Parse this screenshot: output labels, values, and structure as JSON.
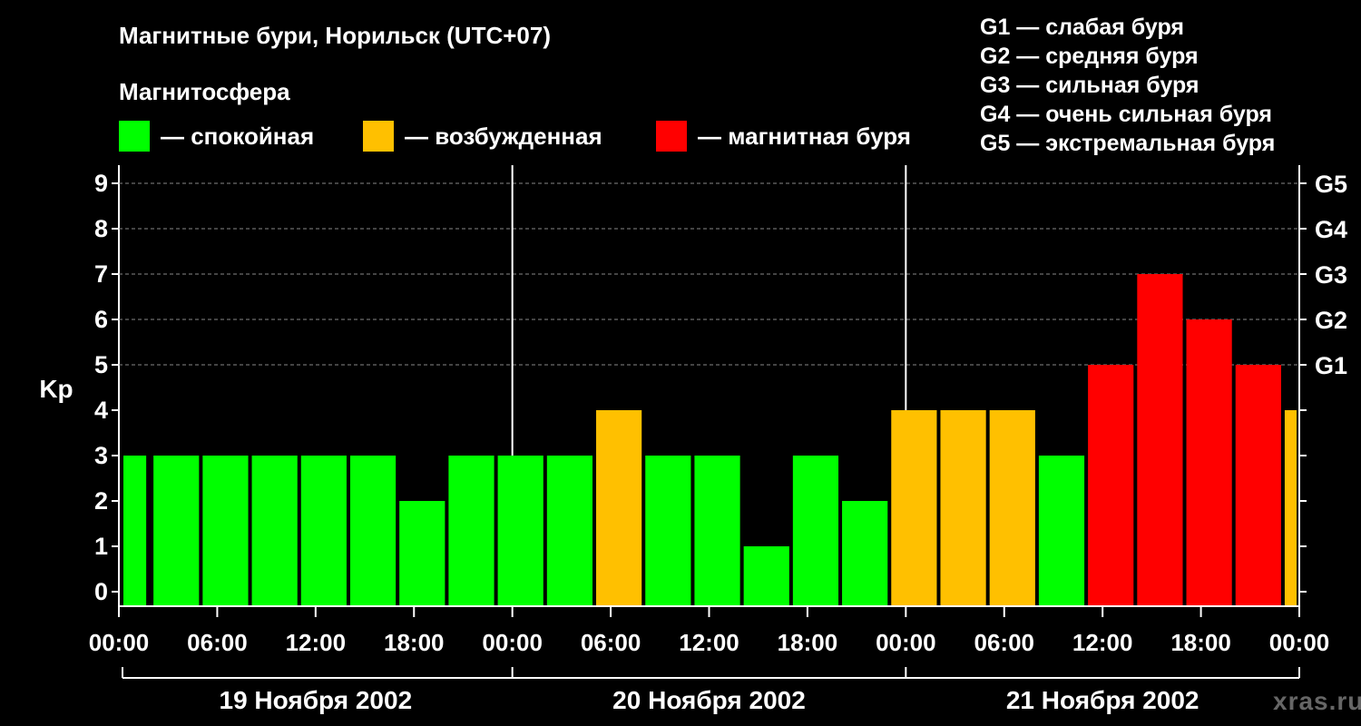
{
  "header": {
    "title": "Магнитные бури, Норильск (UTC+07)",
    "subtitle": "Магнитосфера"
  },
  "legend": [
    {
      "label": "— спокойная",
      "color": "#00ff00"
    },
    {
      "label": "— возбужденная",
      "color": "#ffc000"
    },
    {
      "label": "— магнитная буря",
      "color": "#ff0000"
    }
  ],
  "gscale": [
    "G1 — слабая буря",
    "G2 — средняя буря",
    "G3 — сильная буря",
    "G4 — очень сильная буря",
    "G5 — экстремальная буря"
  ],
  "watermark": "xras.ru",
  "chart_data": {
    "type": "bar",
    "ylabel": "Kp",
    "ylim": [
      0,
      9
    ],
    "yticks": [
      0,
      1,
      2,
      3,
      4,
      5,
      6,
      7,
      8,
      9
    ],
    "right_labels": [
      {
        "y": 5,
        "label": "G1"
      },
      {
        "y": 6,
        "label": "G2"
      },
      {
        "y": 7,
        "label": "G3"
      },
      {
        "y": 8,
        "label": "G4"
      },
      {
        "y": 9,
        "label": "G5"
      }
    ],
    "x_time_ticks": [
      "00:00",
      "06:00",
      "12:00",
      "18:00",
      "00:00",
      "06:00",
      "12:00",
      "18:00",
      "00:00",
      "06:00",
      "12:00",
      "18:00",
      "00:00"
    ],
    "days": [
      "19 Ноября 2002",
      "20 Ноября 2002",
      "21 Ноября 2002"
    ],
    "grid": "horizontal dashed",
    "bars": [
      {
        "start": "19 Ноября 2002 00:00",
        "value": 3,
        "status": "спокойная",
        "color": "#00ff00"
      },
      {
        "start": "19 Ноября 2002 02:00",
        "value": 3,
        "status": "спокойная",
        "color": "#00ff00"
      },
      {
        "start": "19 Ноября 2002 05:00",
        "value": 3,
        "status": "спокойная",
        "color": "#00ff00"
      },
      {
        "start": "19 Ноября 2002 08:00",
        "value": 3,
        "status": "спокойная",
        "color": "#00ff00"
      },
      {
        "start": "19 Ноября 2002 11:00",
        "value": 3,
        "status": "спокойная",
        "color": "#00ff00"
      },
      {
        "start": "19 Ноября 2002 14:00",
        "value": 3,
        "status": "спокойная",
        "color": "#00ff00"
      },
      {
        "start": "19 Ноября 2002 17:00",
        "value": 2,
        "status": "спокойная",
        "color": "#00ff00"
      },
      {
        "start": "19 Ноября 2002 20:00",
        "value": 3,
        "status": "спокойная",
        "color": "#00ff00"
      },
      {
        "start": "19 Ноября 2002 23:00",
        "value": 3,
        "status": "спокойная",
        "color": "#00ff00"
      },
      {
        "start": "20 Ноября 2002 02:00",
        "value": 3,
        "status": "спокойная",
        "color": "#00ff00"
      },
      {
        "start": "20 Ноября 2002 05:00",
        "value": 4,
        "status": "возбужденная",
        "color": "#ffc000"
      },
      {
        "start": "20 Ноября 2002 08:00",
        "value": 3,
        "status": "спокойная",
        "color": "#00ff00"
      },
      {
        "start": "20 Ноября 2002 11:00",
        "value": 3,
        "status": "спокойная",
        "color": "#00ff00"
      },
      {
        "start": "20 Ноября 2002 14:00",
        "value": 1,
        "status": "спокойная",
        "color": "#00ff00"
      },
      {
        "start": "20 Ноября 2002 17:00",
        "value": 3,
        "status": "спокойная",
        "color": "#00ff00"
      },
      {
        "start": "20 Ноября 2002 20:00",
        "value": 2,
        "status": "спокойная",
        "color": "#00ff00"
      },
      {
        "start": "20 Ноября 2002 23:00",
        "value": 4,
        "status": "возбужденная",
        "color": "#ffc000"
      },
      {
        "start": "21 Ноября 2002 02:00",
        "value": 4,
        "status": "возбужденная",
        "color": "#ffc000"
      },
      {
        "start": "21 Ноября 2002 05:00",
        "value": 4,
        "status": "возбужденная",
        "color": "#ffc000"
      },
      {
        "start": "21 Ноября 2002 08:00",
        "value": 3,
        "status": "спокойная",
        "color": "#00ff00"
      },
      {
        "start": "21 Ноября 2002 11:00",
        "value": 5,
        "status": "магнитная буря",
        "color": "#ff0000"
      },
      {
        "start": "21 Ноября 2002 14:00",
        "value": 7,
        "status": "магнитная буря",
        "color": "#ff0000"
      },
      {
        "start": "21 Ноября 2002 17:00",
        "value": 6,
        "status": "магнитная буря",
        "color": "#ff0000"
      },
      {
        "start": "21 Ноября 2002 20:00",
        "value": 5,
        "status": "магнитная буря",
        "color": "#ff0000"
      },
      {
        "start": "21 Ноября 2002 23:00",
        "value": 4,
        "status": "возбужденная",
        "color": "#ffc000"
      }
    ]
  }
}
